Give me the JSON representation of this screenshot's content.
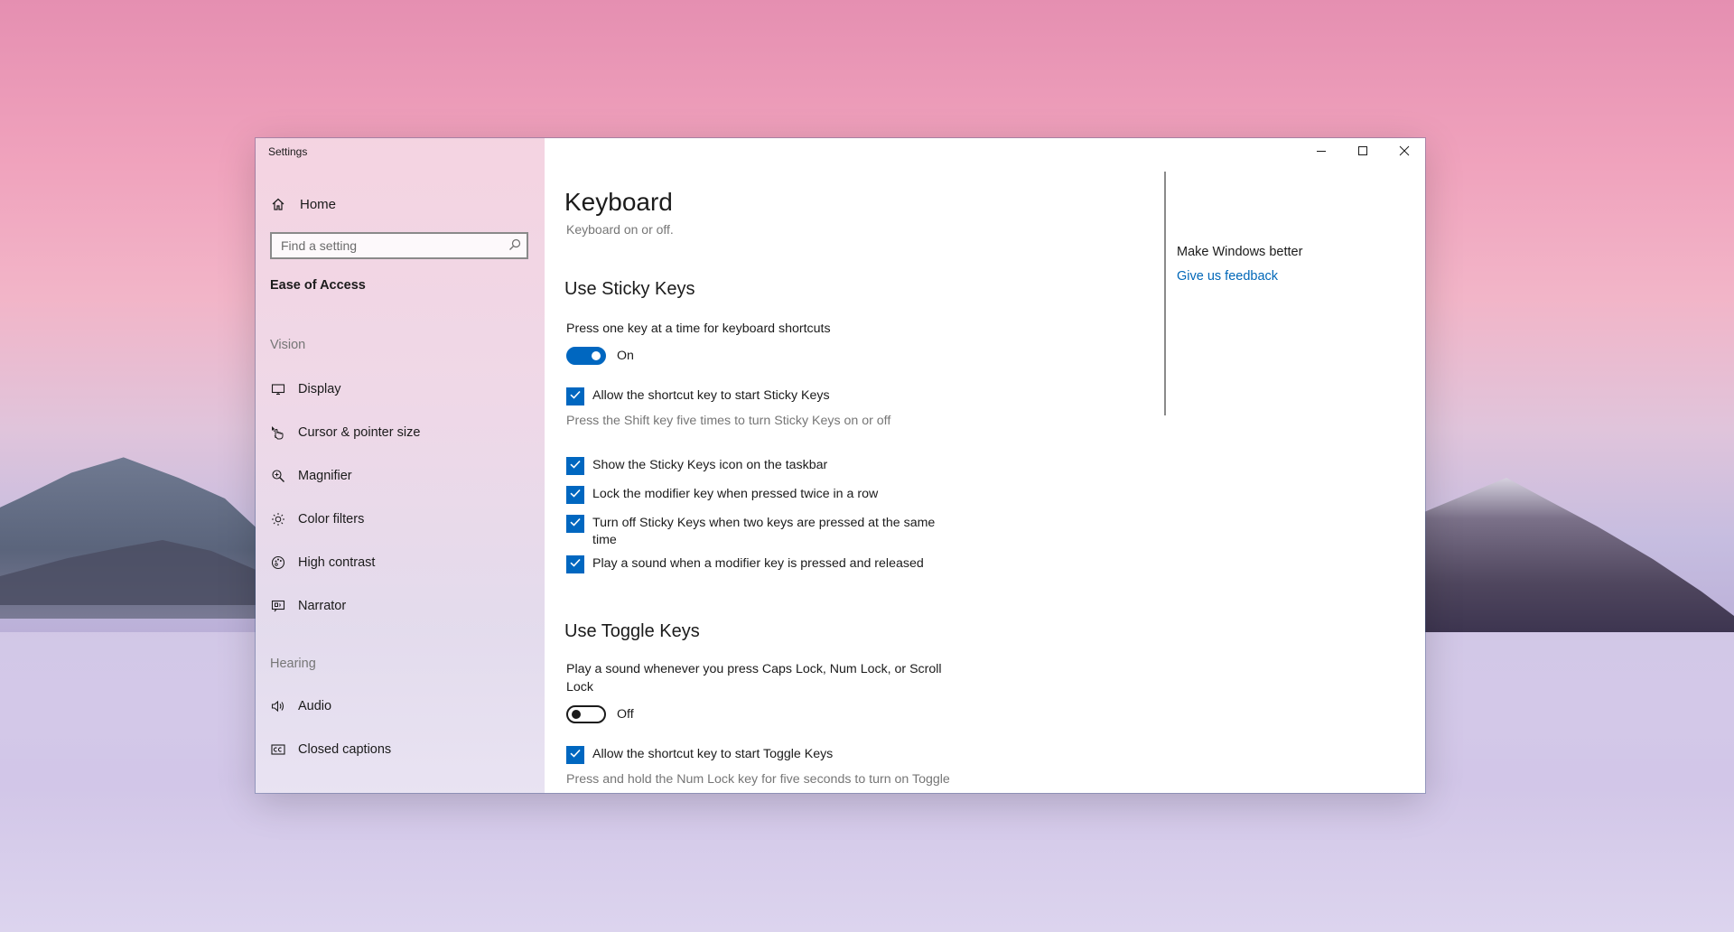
{
  "window": {
    "app_title": "Settings"
  },
  "sidebar": {
    "home_label": "Home",
    "search_placeholder": "Find a setting",
    "current_section": "Ease of Access",
    "groups": [
      {
        "label": "Vision"
      },
      {
        "label": "Hearing"
      }
    ],
    "vision_items": [
      {
        "label": "Display",
        "icon": "display-icon"
      },
      {
        "label": "Cursor & pointer size",
        "icon": "cursor-icon"
      },
      {
        "label": "Magnifier",
        "icon": "magnifier-icon"
      },
      {
        "label": "Color filters",
        "icon": "color-filters-icon"
      },
      {
        "label": "High contrast",
        "icon": "high-contrast-icon"
      },
      {
        "label": "Narrator",
        "icon": "narrator-icon"
      }
    ],
    "hearing_items": [
      {
        "label": "Audio",
        "icon": "audio-icon"
      },
      {
        "label": "Closed captions",
        "icon": "closed-captions-icon"
      }
    ]
  },
  "content": {
    "title": "Keyboard",
    "subtitle": "Keyboard on or off.",
    "side": {
      "heading": "Make Windows better",
      "feedback_link": "Give us feedback"
    },
    "sticky": {
      "heading": "Use Sticky Keys",
      "description": "Press one key at a time for keyboard shortcuts",
      "toggle_on": true,
      "toggle_state": "On",
      "shortcut_label": "Allow the shortcut key to start Sticky Keys",
      "shortcut_checked": true,
      "shortcut_hint": "Press the Shift key five times to turn Sticky Keys on or off",
      "options": [
        {
          "label": "Show the Sticky Keys icon on the taskbar",
          "checked": true
        },
        {
          "label": "Lock the modifier key when pressed twice in a row",
          "checked": true
        },
        {
          "label": "Turn off Sticky Keys when two keys are pressed at the same time",
          "checked": true
        },
        {
          "label": "Play a sound when a modifier key is pressed and released",
          "checked": true
        }
      ]
    },
    "toggle_keys": {
      "heading": "Use Toggle Keys",
      "description": "Play a sound whenever you press Caps Lock, Num Lock, or Scroll Lock",
      "toggle_on": false,
      "toggle_state": "Off",
      "shortcut_label": "Allow the shortcut key to start Toggle Keys",
      "shortcut_checked": true,
      "shortcut_hint": "Press and hold the Num Lock key for five seconds to turn on Toggle"
    }
  },
  "colors": {
    "accent": "#0067c0",
    "link": "#0067b8",
    "secondary_text": "#767676"
  }
}
